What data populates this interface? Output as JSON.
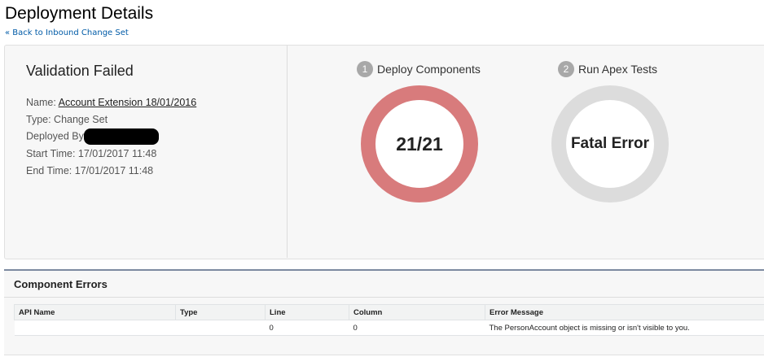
{
  "page": {
    "title": "Deployment Details",
    "back_link": "« Back to Inbound Change Set"
  },
  "summary": {
    "status": "Validation Failed",
    "name_label": "Name:",
    "name_value": "Account Extension 18/01/2016",
    "type": "Type: Change Set",
    "deployed_by_label": "Deployed By",
    "start_time": "Start Time: 17/01/2017 11:48",
    "end_time": "End Time: 17/01/2017 11:48"
  },
  "steps": [
    {
      "number": "1",
      "label": "Deploy Components",
      "value": "21/21",
      "color": "#d87b7c"
    },
    {
      "number": "2",
      "label": "Run Apex Tests",
      "value": "Fatal Error",
      "color": "#dcdcdc"
    }
  ],
  "errors": {
    "title": "Component Errors",
    "columns": [
      "API Name",
      "Type",
      "Line",
      "Column",
      "Error Message"
    ],
    "rows": [
      [
        "",
        "",
        "0",
        "0",
        "The PersonAccount object is missing or isn't visible to you."
      ]
    ]
  }
}
